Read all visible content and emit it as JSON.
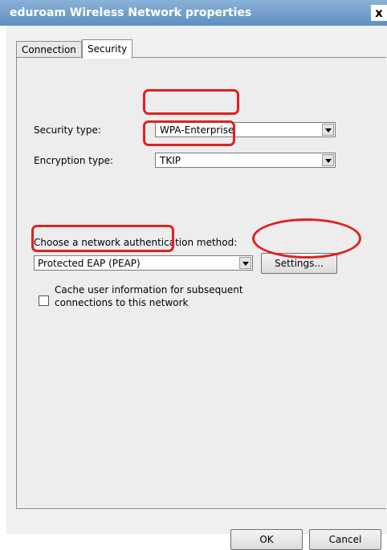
{
  "window": {
    "title": "eduroam Wireless Network properties",
    "close_glyph": "x"
  },
  "tabs": [
    {
      "label": "Connection",
      "selected": false
    },
    {
      "label": "Security",
      "selected": true
    }
  ],
  "security": {
    "security_type_label": "Security type:",
    "security_type_value": "WPA-Enterprise",
    "encryption_type_label": "Encryption type:",
    "encryption_type_value": "TKIP",
    "auth_method_label": "Choose a network authentication method:",
    "auth_method_value": "Protected EAP (PEAP)",
    "settings_button": "Settings...",
    "cache_checkbox_label_line1": "Cache user information for subsequent",
    "cache_checkbox_label_line2": "connections to this network",
    "cache_checkbox_checked": false
  },
  "footer": {
    "ok_label": "OK",
    "cancel_label": "Cancel"
  },
  "annotations": {
    "highlight_color": "#e02020"
  },
  "colors": {
    "titlebar": "#5f8fbf",
    "dialog_background": "#f0f0f0"
  }
}
